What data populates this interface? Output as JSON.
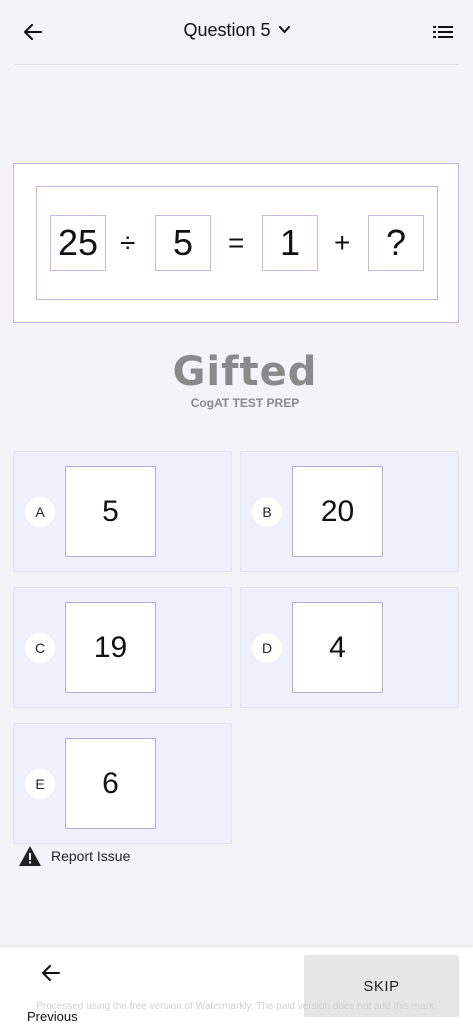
{
  "header": {
    "title": "Question 5",
    "back_icon": "arrow-left-icon",
    "dropdown_icon": "chevron-down-icon",
    "menu_icon": "list-icon"
  },
  "equation": {
    "a": "25",
    "op1": "÷",
    "b": "5",
    "eq": "=",
    "c": "1",
    "op2": "+",
    "d": "?"
  },
  "logo": {
    "word": "Gifted",
    "sub": "CogAT TEST PREP"
  },
  "options": [
    {
      "letter": "A",
      "value": "5"
    },
    {
      "letter": "B",
      "value": "20"
    },
    {
      "letter": "C",
      "value": "19"
    },
    {
      "letter": "D",
      "value": "4"
    },
    {
      "letter": "E",
      "value": "6"
    }
  ],
  "report": {
    "label": "Report Issue",
    "icon": "warning-icon"
  },
  "footer": {
    "previous_label": "Previous",
    "skip_label": "SKIP",
    "watermark": "Processed using the free version of Watermarkly. The paid version does not add this mark."
  },
  "colors": {
    "background": "#f3f3f8",
    "option_bg": "#eef0fb",
    "box_border": "#c9b6e4"
  }
}
